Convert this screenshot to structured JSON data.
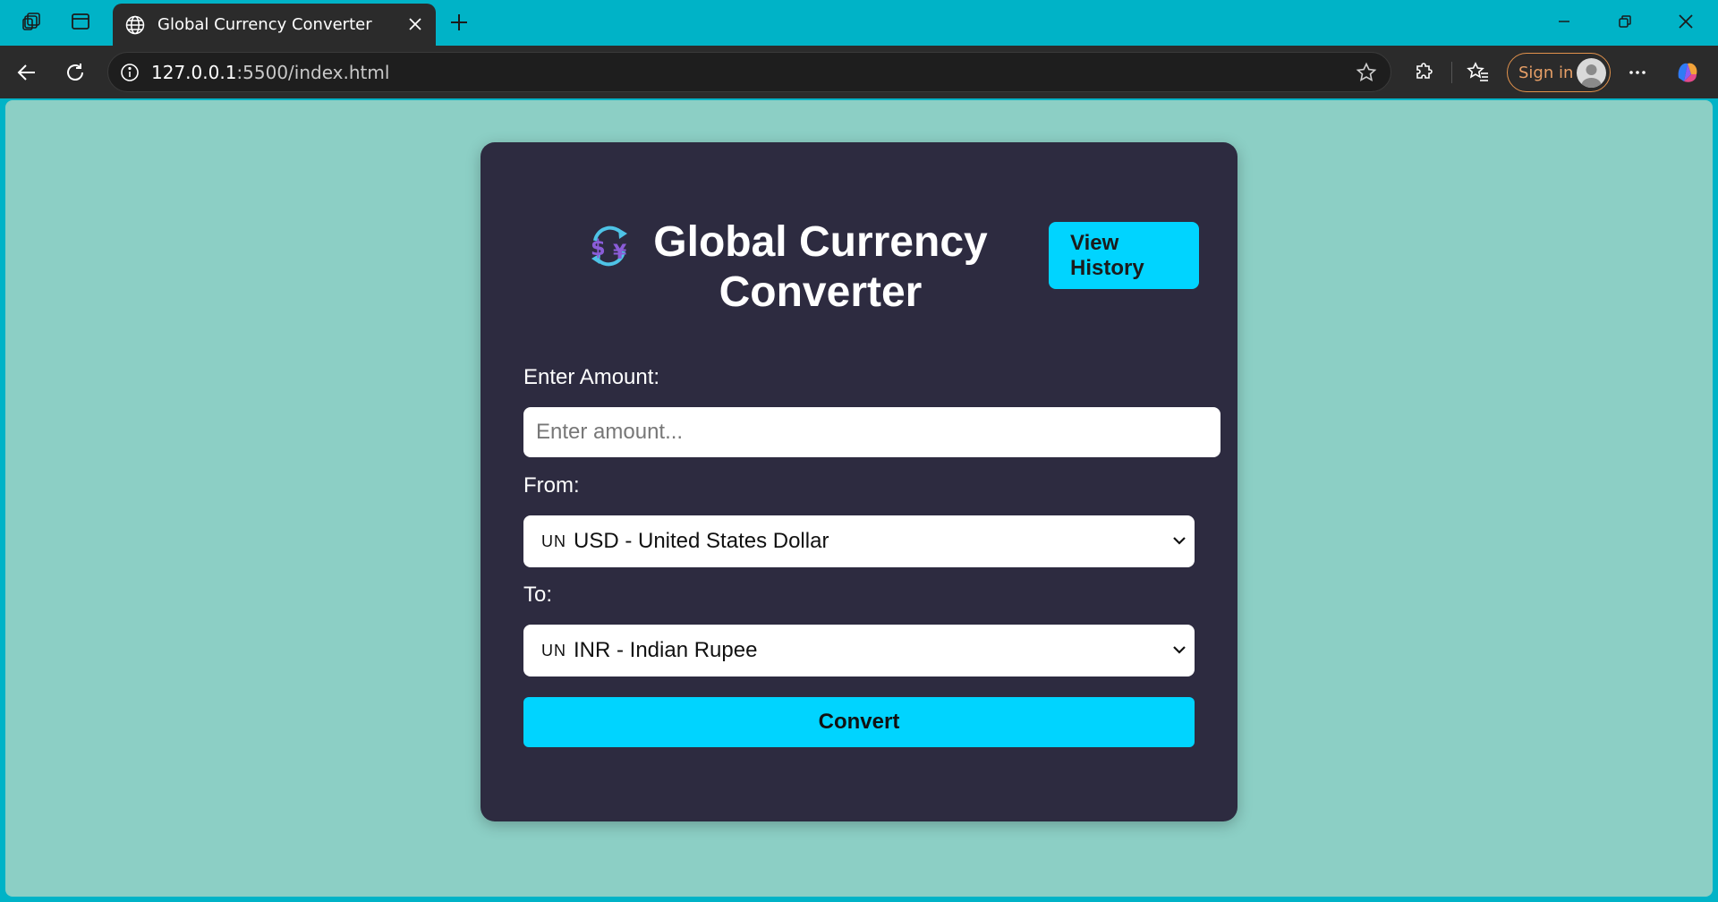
{
  "browser": {
    "tab_title": "Global Currency Converter",
    "url_host": "127.0.0.1",
    "url_rest": ":5500/index.html",
    "signin_label": "Sign in",
    "icons": [
      "workspaces-icon",
      "tab-actions-icon",
      "globe-icon",
      "close-icon",
      "plus-icon",
      "minimize-icon",
      "restore-icon",
      "window-close-icon",
      "back-icon",
      "refresh-icon",
      "info-icon",
      "favorite-star-icon",
      "extensions-icon",
      "favorites-icon",
      "avatar-icon",
      "more-icon",
      "copilot-icon"
    ]
  },
  "app": {
    "title": "Global Currency Converter",
    "history_button": "View History",
    "amount_label": "Enter Amount:",
    "amount_placeholder": "Enter amount...",
    "from_label": "From:",
    "from_flag": "UN",
    "from_value": "USD - United States Dollar",
    "to_label": "To:",
    "to_flag": "UN",
    "to_value": "INR - Indian Rupee",
    "convert_button": "Convert"
  },
  "colors": {
    "browser_accent": "#00b3c7",
    "page_background": "#8ccfc5",
    "card_background": "#2d2b40",
    "button_accent": "#00d4ff"
  }
}
